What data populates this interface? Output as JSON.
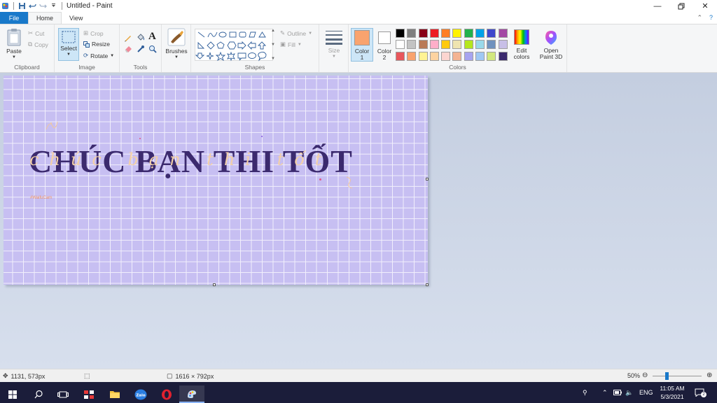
{
  "window": {
    "title": "Untitled - Paint",
    "min_icon": "minimize-icon",
    "max_icon": "restore-icon",
    "close_icon": "close-icon"
  },
  "tabs": {
    "file": "File",
    "home": "Home",
    "view": "View"
  },
  "clipboard": {
    "paste": "Paste",
    "cut": "Cut",
    "copy": "Copy",
    "label": "Clipboard"
  },
  "image": {
    "select": "Select",
    "crop": "Crop",
    "resize": "Resize",
    "rotate": "Rotate",
    "label": "Image"
  },
  "tools": {
    "label": "Tools"
  },
  "brushes": {
    "label": "Brushes"
  },
  "shapes": {
    "outline": "Outline",
    "fill": "Fill",
    "label": "Shapes"
  },
  "size": {
    "label": "Size"
  },
  "colors": {
    "color1": "Color",
    "color1_num": "1",
    "color2": "Color",
    "color2_num": "2",
    "color1_value": "#f9a36e",
    "color2_value": "#ffffff",
    "edit": "Edit",
    "edit2": "colors",
    "paint3d": "Open",
    "paint3d2": "Paint 3D",
    "label": "Colors",
    "palette": [
      "#000000",
      "#7f7f7f",
      "#880015",
      "#ed1c24",
      "#ff7f27",
      "#fff200",
      "#22b14c",
      "#00a2e8",
      "#3f48cc",
      "#a349a4",
      "#ffffff",
      "#c3c3c3",
      "#b97a57",
      "#ffaec9",
      "#ffc90e",
      "#efe4b0",
      "#b5e61d",
      "#99d9ea",
      "#7092be",
      "#c8bfe7",
      "#e8575c",
      "#f9a36e",
      "#fff394",
      "#fdd3a0",
      "#fcd5d0",
      "#f4b493",
      "#a7a4f0",
      "#9fc8f4",
      "#d2e87f",
      "#3b2a6e"
    ]
  },
  "canvas": {
    "main_text": "CHÚC BẠN THI TỐT",
    "script_text": "chúc bạn thi tốt",
    "watermark": "#WaifuCam",
    "accent": "#3b2a6e"
  },
  "status": {
    "cursor_pos": "1131, 573px",
    "image_size": "1616 × 792px",
    "zoom": "50%"
  },
  "taskbar": {
    "lang": "ENG",
    "time": "11:05 AM",
    "date": "5/3/2021"
  }
}
